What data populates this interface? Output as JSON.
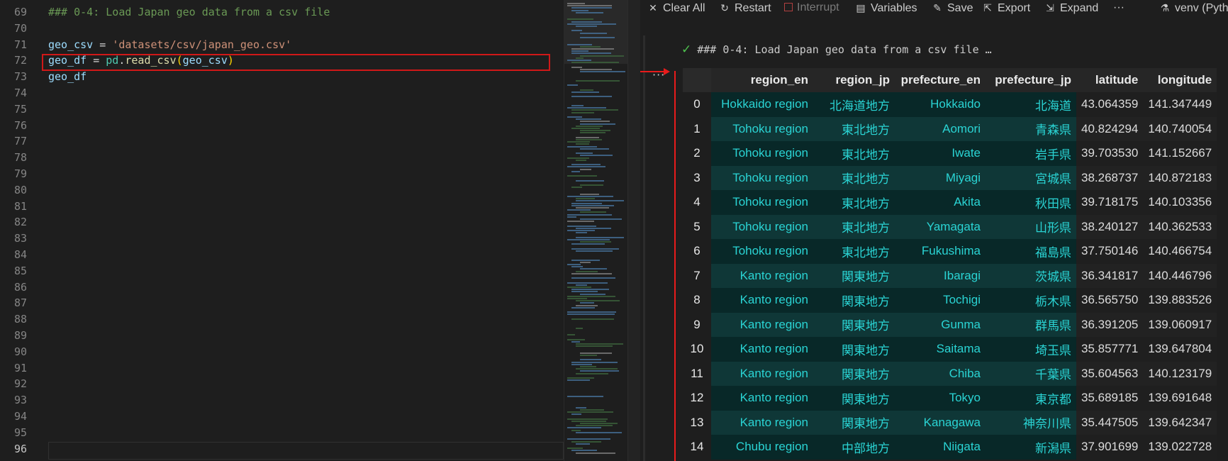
{
  "editor": {
    "lines": [
      {
        "num": "69",
        "tokens": [
          {
            "t": "### 0-4: Load Japan geo data from a csv file",
            "c": "comment"
          }
        ]
      },
      {
        "num": "70",
        "tokens": []
      },
      {
        "num": "71",
        "tokens": [
          {
            "t": "geo_csv",
            "c": "var"
          },
          {
            "t": " = ",
            "c": "op"
          },
          {
            "t": "'datasets/csv/japan_geo.csv'",
            "c": "str"
          }
        ]
      },
      {
        "num": "72",
        "tokens": [
          {
            "t": "geo_df",
            "c": "var"
          },
          {
            "t": " = ",
            "c": "op"
          },
          {
            "t": "pd",
            "c": "mod"
          },
          {
            "t": ".",
            "c": "op"
          },
          {
            "t": "read_csv",
            "c": "fn"
          },
          {
            "t": "(",
            "c": "paren"
          },
          {
            "t": "geo_csv",
            "c": "var"
          },
          {
            "t": ")",
            "c": "paren"
          }
        ]
      },
      {
        "num": "73",
        "tokens": [
          {
            "t": "geo_df",
            "c": "var"
          }
        ]
      },
      {
        "num": "74",
        "tokens": []
      },
      {
        "num": "75",
        "tokens": []
      },
      {
        "num": "76",
        "tokens": []
      },
      {
        "num": "77",
        "tokens": []
      },
      {
        "num": "78",
        "tokens": []
      },
      {
        "num": "79",
        "tokens": []
      },
      {
        "num": "80",
        "tokens": []
      },
      {
        "num": "81",
        "tokens": []
      },
      {
        "num": "82",
        "tokens": []
      },
      {
        "num": "83",
        "tokens": []
      },
      {
        "num": "84",
        "tokens": []
      },
      {
        "num": "85",
        "tokens": []
      },
      {
        "num": "86",
        "tokens": []
      },
      {
        "num": "87",
        "tokens": []
      },
      {
        "num": "88",
        "tokens": []
      },
      {
        "num": "89",
        "tokens": []
      },
      {
        "num": "90",
        "tokens": []
      },
      {
        "num": "91",
        "tokens": []
      },
      {
        "num": "92",
        "tokens": []
      },
      {
        "num": "93",
        "tokens": []
      },
      {
        "num": "94",
        "tokens": []
      },
      {
        "num": "95",
        "tokens": []
      },
      {
        "num": "96",
        "tokens": [],
        "active": true
      }
    ]
  },
  "toolbar": {
    "clear_all": "Clear All",
    "restart": "Restart",
    "interrupt": "Interrupt",
    "variables": "Variables",
    "save": "Save",
    "export": "Export",
    "expand": "Expand",
    "more": "···",
    "kernel": "venv (Pyth"
  },
  "cell": {
    "header": "### 0-4: Load Japan geo data from a csv file …",
    "ellipsis": "···"
  },
  "dataframe": {
    "columns": [
      "region_en",
      "region_jp",
      "prefecture_en",
      "prefecture_jp",
      "latitude",
      "longitude"
    ],
    "rows": [
      [
        "0",
        "Hokkaido region",
        "北海道地方",
        "Hokkaido",
        "北海道",
        "43.064359",
        "141.347449"
      ],
      [
        "1",
        "Tohoku region",
        "東北地方",
        "Aomori",
        "青森県",
        "40.824294",
        "140.740054"
      ],
      [
        "2",
        "Tohoku region",
        "東北地方",
        "Iwate",
        "岩手県",
        "39.703530",
        "141.152667"
      ],
      [
        "3",
        "Tohoku region",
        "東北地方",
        "Miyagi",
        "宮城県",
        "38.268737",
        "140.872183"
      ],
      [
        "4",
        "Tohoku region",
        "東北地方",
        "Akita",
        "秋田県",
        "39.718175",
        "140.103356"
      ],
      [
        "5",
        "Tohoku region",
        "東北地方",
        "Yamagata",
        "山形県",
        "38.240127",
        "140.362533"
      ],
      [
        "6",
        "Tohoku region",
        "東北地方",
        "Fukushima",
        "福島県",
        "37.750146",
        "140.466754"
      ],
      [
        "7",
        "Kanto region",
        "関東地方",
        "Ibaragi",
        "茨城県",
        "36.341817",
        "140.446796"
      ],
      [
        "8",
        "Kanto region",
        "関東地方",
        "Tochigi",
        "栃木県",
        "36.565750",
        "139.883526"
      ],
      [
        "9",
        "Kanto region",
        "関東地方",
        "Gunma",
        "群馬県",
        "36.391205",
        "139.060917"
      ],
      [
        "10",
        "Kanto region",
        "関東地方",
        "Saitama",
        "埼玉県",
        "35.857771",
        "139.647804"
      ],
      [
        "11",
        "Kanto region",
        "関東地方",
        "Chiba",
        "千葉県",
        "35.604563",
        "140.123179"
      ],
      [
        "12",
        "Kanto region",
        "関東地方",
        "Tokyo",
        "東京都",
        "35.689185",
        "139.691648"
      ],
      [
        "13",
        "Kanto region",
        "関東地方",
        "Kanagawa",
        "神奈川県",
        "35.447505",
        "139.642347"
      ],
      [
        "14",
        "Chubu region",
        "中部地方",
        "Niigata",
        "新潟県",
        "37.901699",
        "139.022728"
      ]
    ]
  }
}
